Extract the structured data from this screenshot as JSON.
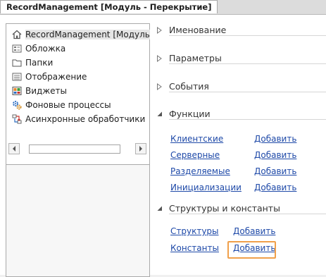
{
  "window": {
    "tab_title": "RecordManagement [Модуль - Перекрытие]"
  },
  "tree": {
    "items": [
      {
        "label": "RecordManagement [Модуль",
        "icon": "home-icon"
      },
      {
        "label": "Обложка",
        "icon": "form-icon"
      },
      {
        "label": "Папки",
        "icon": "folder-icon"
      },
      {
        "label": "Отображение",
        "icon": "list-icon"
      },
      {
        "label": "Виджеты",
        "icon": "widget-icon"
      },
      {
        "label": "Фоновые процессы",
        "icon": "gear-icon"
      },
      {
        "label": "Асинхронные обработчики",
        "icon": "async-icon"
      }
    ]
  },
  "sections": {
    "naming": "Именование",
    "parameters": "Параметры",
    "events": "События",
    "functions": {
      "title": "Функции",
      "rows": [
        {
          "name": "Клиентские",
          "action": "Добавить"
        },
        {
          "name": "Серверные",
          "action": "Добавить"
        },
        {
          "name": "Разделяемые",
          "action": "Добавить"
        },
        {
          "name": "Инициализации",
          "action": "Добавить"
        }
      ]
    },
    "structures": {
      "title": "Структуры и константы",
      "rows": [
        {
          "name": "Структуры",
          "action": "Добавить"
        },
        {
          "name": "Константы",
          "action": "Добавить"
        }
      ]
    }
  },
  "colors": {
    "link": "#1e49a8",
    "highlight": "#f0a04b"
  }
}
